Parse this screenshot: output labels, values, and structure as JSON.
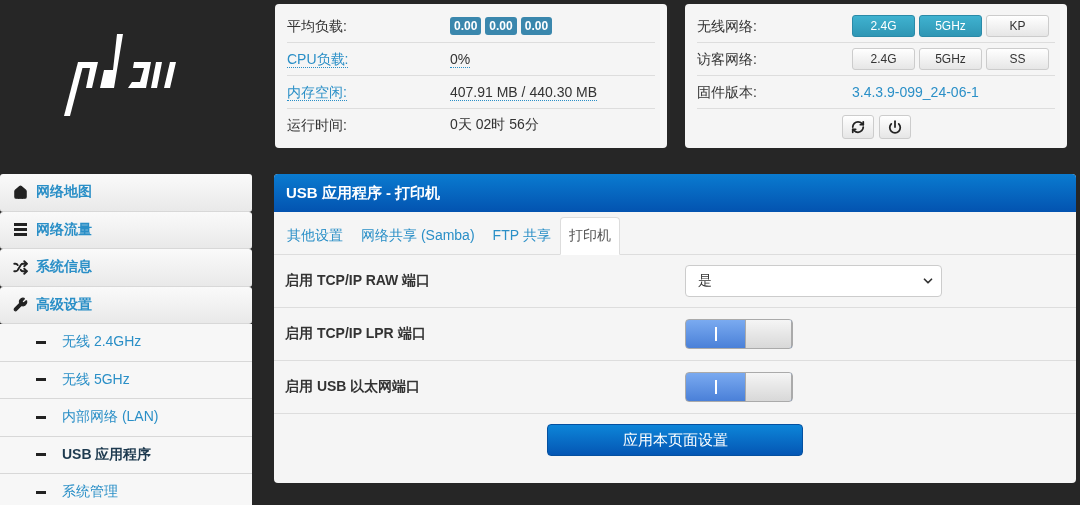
{
  "status": {
    "rows": [
      {
        "label": "平均负载:",
        "linked": false,
        "kind": "badges",
        "badges": [
          "0.00",
          "0.00",
          "0.00"
        ]
      },
      {
        "label": "CPU负载:",
        "linked": true,
        "kind": "text",
        "value": "0%"
      },
      {
        "label": "内存空闲:",
        "linked": true,
        "kind": "text",
        "value": "407.91 MB / 440.30 MB"
      },
      {
        "label": "运行时间:",
        "linked": false,
        "kind": "text",
        "value": "0天 02时 56分"
      }
    ]
  },
  "network": {
    "rows": [
      {
        "label": "无线网络:",
        "kind": "buttons",
        "buttons": [
          {
            "label": "2.4G",
            "selected": true
          },
          {
            "label": "5GHz",
            "selected": true
          },
          {
            "label": "KP",
            "selected": false
          }
        ]
      },
      {
        "label": "访客网络:",
        "kind": "buttons",
        "buttons": [
          {
            "label": "2.4G",
            "selected": false
          },
          {
            "label": "5GHz",
            "selected": false
          },
          {
            "label": "SS",
            "selected": false
          }
        ]
      },
      {
        "label": "固件版本:",
        "kind": "link",
        "value": "3.4.3.9-099_24-06-1"
      }
    ],
    "actions": [
      {
        "kind": "reboot"
      },
      {
        "kind": "power"
      }
    ]
  },
  "sidebar": {
    "items": [
      {
        "label": "网络地图",
        "selected": false
      },
      {
        "label": "网络流量",
        "selected": false
      },
      {
        "label": "系统信息",
        "selected": false
      },
      {
        "label": "高级设置",
        "selected": false,
        "children": [
          {
            "label": "无线 2.4GHz",
            "selected": false
          },
          {
            "label": "无线 5GHz",
            "selected": false
          },
          {
            "label": "内部网络 (LAN)",
            "selected": false
          },
          {
            "label": "USB 应用程序",
            "selected": true
          },
          {
            "label": "系统管理",
            "selected": false
          }
        ]
      }
    ]
  },
  "panel": {
    "title": "USB 应用程序 - 打印机",
    "tabs": [
      {
        "label": "其他设置",
        "selected": false
      },
      {
        "label": "网络共享 (Samba)",
        "selected": false
      },
      {
        "label": "FTP 共享",
        "selected": false
      },
      {
        "label": "打印机",
        "selected": true
      }
    ],
    "settings": [
      {
        "label": "启用 TCP/IP RAW 端口",
        "kind": "select",
        "value": "是"
      },
      {
        "label": "启用 TCP/IP LPR 端口",
        "kind": "toggle",
        "on": true
      },
      {
        "label": "启用 USB 以太网端口",
        "kind": "toggle",
        "on": true
      }
    ],
    "apply_button": "应用本页面设置"
  }
}
